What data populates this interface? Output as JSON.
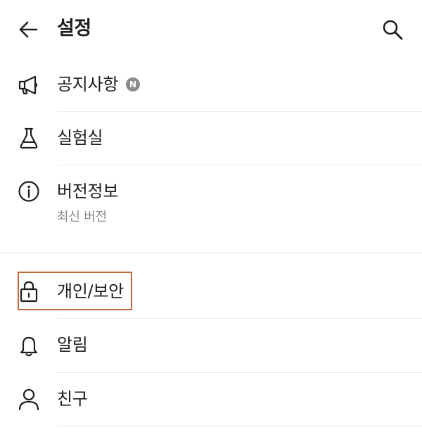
{
  "header": {
    "title": "설정",
    "back_icon": "arrow-left-icon",
    "search_icon": "search-icon"
  },
  "menu": {
    "notice": {
      "label": "공지사항",
      "badge": "N",
      "icon": "megaphone-icon"
    },
    "lab": {
      "label": "실험실",
      "icon": "flask-icon"
    },
    "version": {
      "label": "버전정보",
      "sub": "최신 버전",
      "icon": "info-icon"
    },
    "privacy": {
      "label": "개인/보안",
      "icon": "lock-icon"
    },
    "notifications": {
      "label": "알림",
      "icon": "bell-icon"
    },
    "friends": {
      "label": "친구",
      "icon": "person-icon"
    }
  },
  "colors": {
    "text": "#1e1e1e",
    "subtext": "#8a8a8a",
    "badge": "#8c8c8c",
    "highlight": "#c5663a",
    "divider": "#ececec"
  }
}
